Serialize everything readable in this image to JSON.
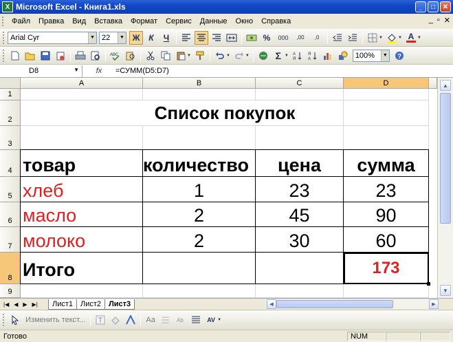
{
  "window": {
    "title": "Microsoft Excel - Книга1.xls",
    "app_icon": "X"
  },
  "menu": {
    "items": [
      "Файл",
      "Правка",
      "Вид",
      "Вставка",
      "Формат",
      "Сервис",
      "Данные",
      "Окно",
      "Справка"
    ],
    "doc_controls": [
      "_",
      "▫",
      "✕"
    ]
  },
  "format_toolbar": {
    "font_name": "Arial Cyr",
    "font_size": "22",
    "bold": "Ж",
    "italic": "К",
    "underline": "Ч",
    "percent": "%",
    "thousands": "000",
    "dec_inc": ",00",
    "dec_dec": ",0",
    "font_color_letter": "A"
  },
  "standard_toolbar": {
    "zoom": "100%",
    "sigma": "Σ"
  },
  "formula_bar": {
    "name_box": "D8",
    "fx_label": "fx",
    "formula": "=СУММ(D5:D7)"
  },
  "columns": [
    "A",
    "B",
    "C",
    "D"
  ],
  "rows": [
    "1",
    "2",
    "3",
    "4",
    "5",
    "6",
    "7",
    "8",
    "9"
  ],
  "sheet": {
    "title": "Список покупок",
    "headers": [
      "товар",
      "количество",
      "цена",
      "сумма"
    ],
    "items": [
      {
        "name": "хлеб",
        "qty": "1",
        "price": "23",
        "sum": "23"
      },
      {
        "name": "масло",
        "qty": "2",
        "price": "45",
        "sum": "90"
      },
      {
        "name": "молоко",
        "qty": "2",
        "price": "30",
        "sum": "60"
      }
    ],
    "total_label": "Итого",
    "total_value": "173"
  },
  "tabs": [
    "Лист1",
    "Лист2",
    "Лист3"
  ],
  "active_tab": "Лист3",
  "drawing_toolbar": {
    "edit_text": "Изменить текст..."
  },
  "status": {
    "ready": "Готово",
    "num": "NUM"
  },
  "colors": {
    "title_bar": "#1248c6",
    "selected_header": "#f7c779",
    "item_text": "#e02020",
    "total_value": "#e02020"
  }
}
